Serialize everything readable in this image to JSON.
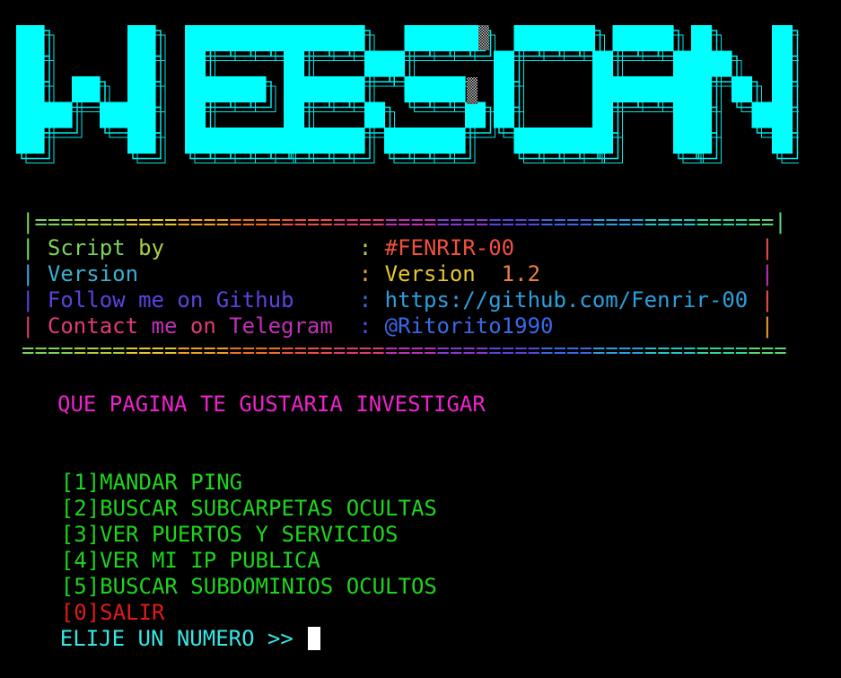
{
  "banner": {
    "text": "WEBSCAN",
    "letters": [
      "W",
      "E",
      "B",
      "S",
      "C",
      "A",
      "N"
    ],
    "fill_color": "#00ffff",
    "outline_color": "#00e8e8",
    "shade_color": "#b0b0b0"
  },
  "info_box": {
    "top_border": "|=========================================================|",
    "bottom_border": "===========================================================",
    "rows": [
      {
        "label_words": [
          "Script",
          "by"
        ],
        "separator": ":",
        "value_parts": [
          "#FENRIR-00"
        ]
      },
      {
        "label_words": [
          "Version"
        ],
        "separator": ":",
        "value_parts": [
          "Version",
          "1.2"
        ]
      },
      {
        "label_words": [
          "Follow",
          "me",
          "on",
          "Github"
        ],
        "separator": ":",
        "value_parts": [
          "https://github.com/Fenrir-00"
        ]
      },
      {
        "label_words": [
          "Contact",
          "me",
          "on",
          "Telegram"
        ],
        "separator": ":",
        "value_parts": [
          "@Ritorito1990"
        ]
      }
    ]
  },
  "prompt_question": "QUE PAGINA TE GUSTARIA INVESTIGAR",
  "menu": [
    {
      "key": "[1]",
      "label": "MANDAR PING"
    },
    {
      "key": "[2]",
      "label": "BUSCAR SUBCARPETAS OCULTAS"
    },
    {
      "key": "[3]",
      "label": "VER PUERTOS Y SERVICIOS"
    },
    {
      "key": "[4]",
      "label": "VER MI IP PUBLICA"
    },
    {
      "key": "[5]",
      "label": "BUSCAR SUBDOMINIOS OCULTOS"
    },
    {
      "key": "[0]",
      "label": "SALIR"
    }
  ],
  "input_prompt": "ELIJE UN NUMERO >> ",
  "colors": {
    "background": "#000000",
    "menu_green": "#1ed51e",
    "exit_red": "#e01b1b",
    "question_magenta": "#ee22cc",
    "prompt_cyan": "#37e6e6",
    "rainbow": [
      "#7ad35a",
      "#b0d038",
      "#e8c82a",
      "#f0a020",
      "#f07020",
      "#f05040",
      "#e03a7a",
      "#c030b8",
      "#8a36d8",
      "#5a44e0",
      "#3a68e8",
      "#2aa0e0",
      "#22c8c8",
      "#2ad8a0",
      "#5ad870"
    ]
  }
}
